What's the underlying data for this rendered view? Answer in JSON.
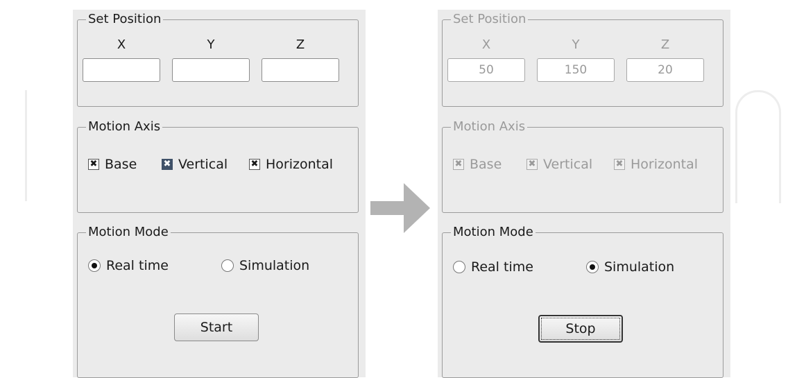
{
  "left": {
    "position": {
      "legend": "Set Position",
      "x_label": "X",
      "y_label": "Y",
      "z_label": "Z",
      "x_value": "",
      "y_value": "",
      "z_value": ""
    },
    "axis": {
      "legend": "Motion Axis",
      "base": "Base",
      "vertical": "Vertical",
      "horizontal": "Horizontal"
    },
    "mode": {
      "legend": "Motion Mode",
      "realtime": "Real time",
      "simulation": "Simulation",
      "selected": "Real time",
      "button": "Start"
    }
  },
  "right": {
    "position": {
      "legend": "Set Position",
      "x_label": "X",
      "y_label": "Y",
      "z_label": "Z",
      "x_value": "50",
      "y_value": "150",
      "z_value": "20"
    },
    "axis": {
      "legend": "Motion Axis",
      "base": "Base",
      "vertical": "Vertical",
      "horizontal": "Horizontal"
    },
    "mode": {
      "legend": "Motion Mode",
      "realtime": "Real time",
      "simulation": "Simulation",
      "selected": "Simulation",
      "button": "Stop"
    }
  },
  "icons": {
    "check_mark": "✖",
    "arrow": "right-arrow-icon"
  },
  "colors": {
    "panel_bg": "#ebebeb",
    "disabled_text": "#9a9a9a",
    "arrow": "#b3b3b3"
  }
}
